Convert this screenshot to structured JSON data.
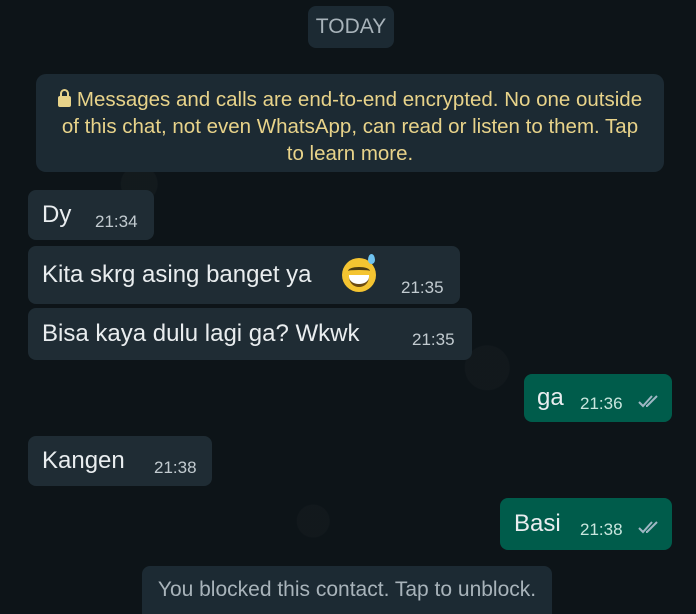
{
  "date_chip": "TODAY",
  "encryption_notice": "Messages and calls are end-to-end encrypted. No one outside of this chat, not even WhatsApp, can read or listen to them. Tap to learn more.",
  "messages": [
    {
      "direction": "in",
      "text": "Dy",
      "time": "21:34"
    },
    {
      "direction": "in",
      "text": "Kita skrg asing banget ya",
      "time": "21:35",
      "emoji": "grinning-sweat-emoji"
    },
    {
      "direction": "in",
      "text": "Bisa kaya dulu lagi ga? Wkwk",
      "time": "21:35"
    },
    {
      "direction": "out",
      "text": "ga",
      "time": "21:36",
      "status": "delivered-double-tick"
    },
    {
      "direction": "in",
      "text": "Kangen",
      "time": "21:38"
    },
    {
      "direction": "out",
      "text": "Basi",
      "time": "21:38",
      "status": "delivered-double-tick"
    }
  ],
  "blocked_banner": "You blocked this contact. Tap to unblock.",
  "colors": {
    "background": "#0d1418",
    "incoming_bubble": "#1f2c34",
    "outgoing_bubble": "#005c4b",
    "system_bubble": "#1c2a33",
    "encryption_text": "#e8d38a"
  }
}
